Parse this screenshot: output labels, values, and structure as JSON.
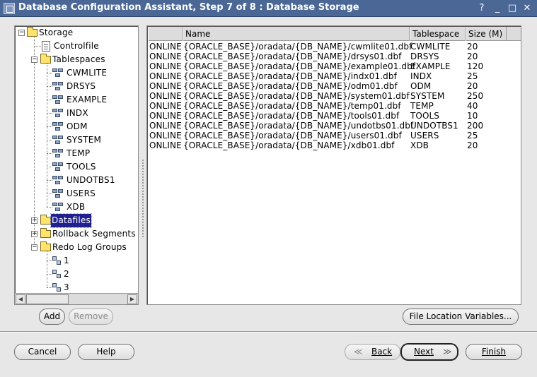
{
  "window": {
    "title": "Database Configuration Assistant, Step 7 of 8 : Database Storage",
    "controls": [
      "?",
      "_",
      "□",
      "✕"
    ]
  },
  "tree": {
    "root": "Storage",
    "controlfile": "Controlfile",
    "tablespaces_label": "Tablespaces",
    "tablespaces": [
      "CWMLITE",
      "DRSYS",
      "EXAMPLE",
      "INDX",
      "ODM",
      "SYSTEM",
      "TEMP",
      "TOOLS",
      "UNDOTBS1",
      "USERS",
      "XDB"
    ],
    "datafiles": "Datafiles",
    "rollback": "Rollback Segments",
    "redo": "Redo Log Groups",
    "redo_groups": [
      "1",
      "2",
      "3"
    ]
  },
  "table": {
    "columns": [
      "",
      "Name",
      "Tablespace",
      "Size (M)"
    ],
    "rows": [
      [
        "ONLINE",
        "{ORACLE_BASE}/oradata/{DB_NAME}/cwmlite01.dbf",
        "CWMLITE",
        "20"
      ],
      [
        "ONLINE",
        "{ORACLE_BASE}/oradata/{DB_NAME}/drsys01.dbf",
        "DRSYS",
        "20"
      ],
      [
        "ONLINE",
        "{ORACLE_BASE}/oradata/{DB_NAME}/example01.dbf",
        "EXAMPLE",
        "120"
      ],
      [
        "ONLINE",
        "{ORACLE_BASE}/oradata/{DB_NAME}/indx01.dbf",
        "INDX",
        "25"
      ],
      [
        "ONLINE",
        "{ORACLE_BASE}/oradata/{DB_NAME}/odm01.dbf",
        "ODM",
        "20"
      ],
      [
        "ONLINE",
        "{ORACLE_BASE}/oradata/{DB_NAME}/system01.dbf",
        "SYSTEM",
        "250"
      ],
      [
        "ONLINE",
        "{ORACLE_BASE}/oradata/{DB_NAME}/temp01.dbf",
        "TEMP",
        "40"
      ],
      [
        "ONLINE",
        "{ORACLE_BASE}/oradata/{DB_NAME}/tools01.dbf",
        "TOOLS",
        "10"
      ],
      [
        "ONLINE",
        "{ORACLE_BASE}/oradata/{DB_NAME}/undotbs01.dbf",
        "UNDOTBS1",
        "200"
      ],
      [
        "ONLINE",
        "{ORACLE_BASE}/oradata/{DB_NAME}/users01.dbf",
        "USERS",
        "25"
      ],
      [
        "ONLINE",
        "{ORACLE_BASE}/oradata/{DB_NAME}/xdb01.dbf",
        "XDB",
        "20"
      ]
    ]
  },
  "buttons": {
    "add": "Add",
    "remove": "Remove",
    "file_location": "File Location Variables...",
    "cancel": "Cancel",
    "help": "Help",
    "back": "Back",
    "next": "Next",
    "finish": "Finish"
  }
}
